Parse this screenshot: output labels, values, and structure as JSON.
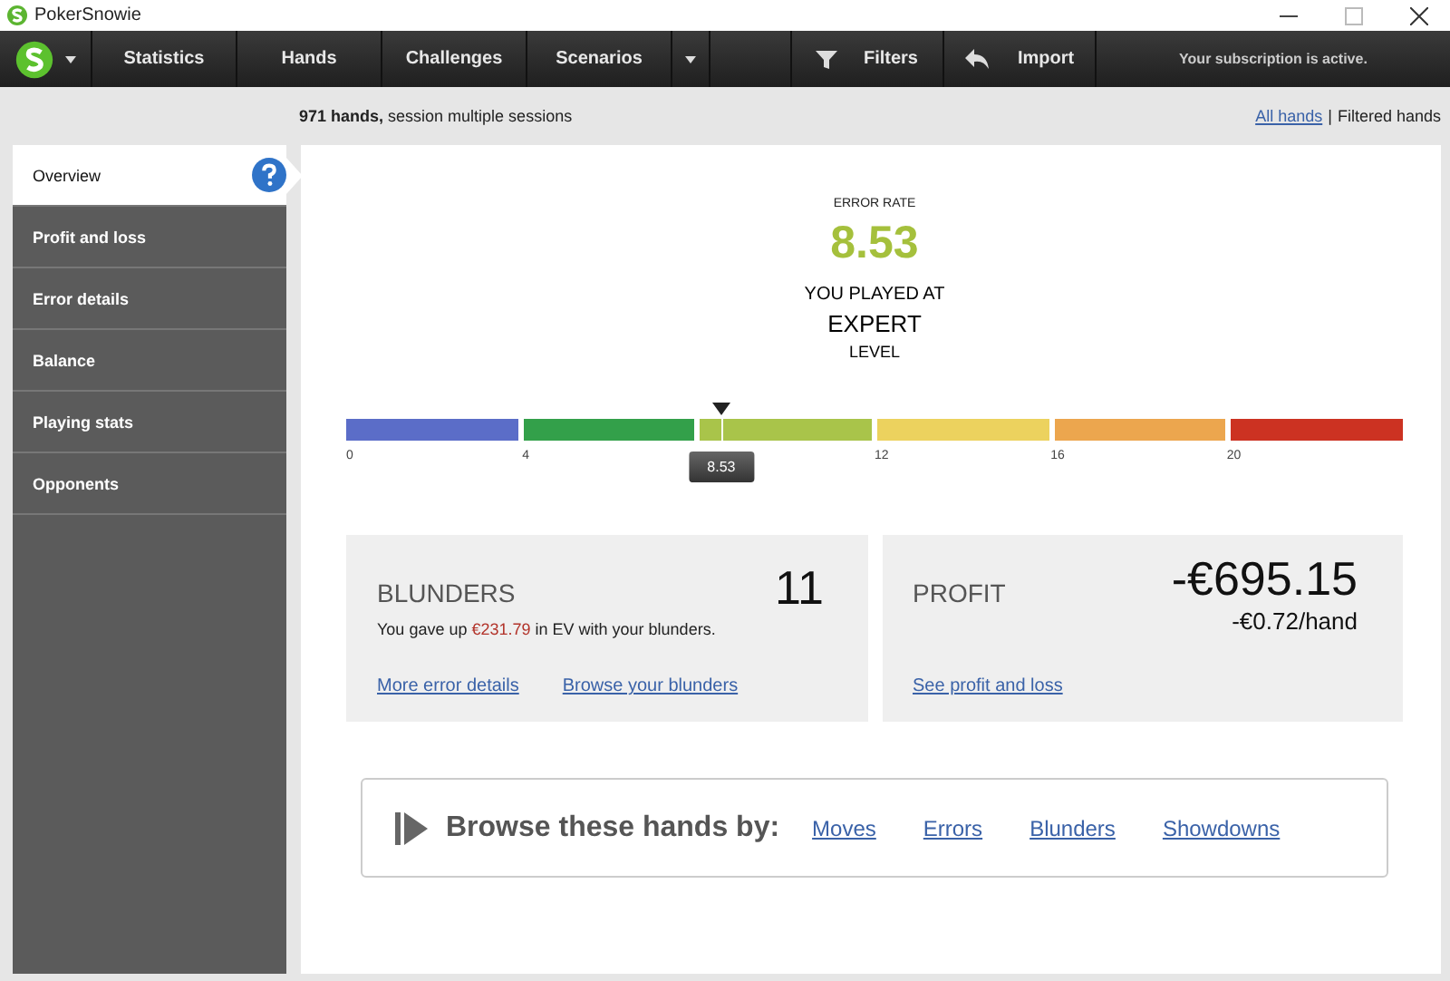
{
  "window": {
    "title": "PokerSnowie"
  },
  "nav": {
    "tabs": [
      "Statistics",
      "Hands",
      "Challenges",
      "Scenarios"
    ],
    "tools": [
      {
        "kind": "filter",
        "label": "Filters"
      },
      {
        "kind": "import",
        "label": "Import"
      }
    ],
    "status": "Your subscription is active."
  },
  "header": {
    "summary": "**971 hands,** session multiple sessions",
    "all_link": "All hands",
    "separator": "|",
    "current": "Filtered hands"
  },
  "sidebar": {
    "items": [
      {
        "label": "Overview",
        "selected": true,
        "help": true
      },
      {
        "label": "Profit and loss",
        "selected": false,
        "help": false
      },
      {
        "label": "Error details",
        "selected": false,
        "help": false
      },
      {
        "label": "Balance",
        "selected": false,
        "help": false
      },
      {
        "label": "Playing stats",
        "selected": false,
        "help": false
      },
      {
        "label": "Opponents",
        "selected": false,
        "help": false
      }
    ]
  },
  "error": {
    "label": "ERROR RATE",
    "value": "8.53",
    "played_at": "YOU PLAYED AT",
    "level_name": "EXPERT",
    "level_word": "LEVEL",
    "segments": [
      {
        "color": "#5b6dc8"
      },
      {
        "color": "#33a04a"
      },
      {
        "color": "#a9c44a"
      },
      {
        "color": "#ecd25e"
      },
      {
        "color": "#eca64e"
      },
      {
        "color": "#cc3222"
      }
    ],
    "ticks": [
      "0",
      "4",
      "12",
      "16",
      "20"
    ],
    "marker": {
      "level": 0.355,
      "label": "8.53"
    }
  },
  "blunders": {
    "title": "BLUNDERS",
    "count": "11",
    "before": "You gave up ",
    "amount": "€231.79",
    "after": " in EV with your blunders.",
    "links": [
      "More error details",
      "Browse your blunders"
    ]
  },
  "profit": {
    "title": "PROFIT",
    "total": "-€695.15",
    "per_hand": "-€0.72/hand",
    "links": [
      "See profit and loss"
    ]
  },
  "browse": {
    "label": "Browse these hands by:",
    "links": [
      "Moves",
      "Errors",
      "Blunders",
      "Showdowns"
    ]
  }
}
